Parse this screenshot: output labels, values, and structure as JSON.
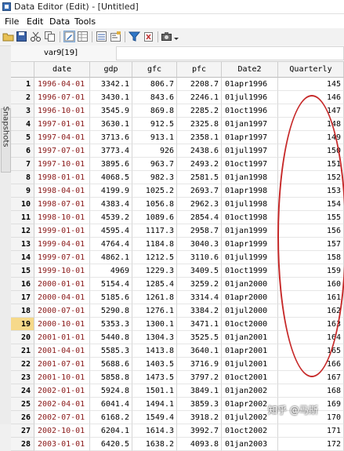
{
  "window": {
    "title": "Data Editor (Edit) - [Untitled]"
  },
  "menu": [
    "File",
    "Edit",
    "Data",
    "Tools"
  ],
  "toolbar": {
    "icons": [
      "open-icon",
      "save-icon",
      "cut-icon",
      "copy-icon",
      "edit-mode-icon",
      "browse-mode-icon",
      "variables-icon",
      "properties-icon",
      "filter-icon",
      "delete-icon",
      "snapshot-icon",
      "dropdown-icon"
    ]
  },
  "sidebar": {
    "label": "Snapshots"
  },
  "varbar": {
    "name": "var9[19]"
  },
  "grid": {
    "columns": [
      "date",
      "gdp",
      "gfc",
      "pfc",
      "Date2",
      "Quarterly"
    ],
    "selected_row": 19,
    "rows": [
      {
        "n": "1",
        "date": "1996-04-01",
        "gdp": "3342.1",
        "gfc": "806.7",
        "pfc": "2208.7",
        "d2": "01apr1996",
        "q": "145"
      },
      {
        "n": "2",
        "date": "1996-07-01",
        "gdp": "3430.1",
        "gfc": "843.6",
        "pfc": "2246.1",
        "d2": "01jul1996",
        "q": "146"
      },
      {
        "n": "3",
        "date": "1996-10-01",
        "gdp": "3545.9",
        "gfc": "869.8",
        "pfc": "2285.2",
        "d2": "01oct1996",
        "q": "147"
      },
      {
        "n": "4",
        "date": "1997-01-01",
        "gdp": "3630.1",
        "gfc": "912.5",
        "pfc": "2325.8",
        "d2": "01jan1997",
        "q": "148"
      },
      {
        "n": "5",
        "date": "1997-04-01",
        "gdp": "3713.6",
        "gfc": "913.1",
        "pfc": "2358.1",
        "d2": "01apr1997",
        "q": "149"
      },
      {
        "n": "6",
        "date": "1997-07-01",
        "gdp": "3773.4",
        "gfc": "926",
        "pfc": "2438.6",
        "d2": "01jul1997",
        "q": "150"
      },
      {
        "n": "7",
        "date": "1997-10-01",
        "gdp": "3895.6",
        "gfc": "963.7",
        "pfc": "2493.2",
        "d2": "01oct1997",
        "q": "151"
      },
      {
        "n": "8",
        "date": "1998-01-01",
        "gdp": "4068.5",
        "gfc": "982.3",
        "pfc": "2581.5",
        "d2": "01jan1998",
        "q": "152"
      },
      {
        "n": "9",
        "date": "1998-04-01",
        "gdp": "4199.9",
        "gfc": "1025.2",
        "pfc": "2693.7",
        "d2": "01apr1998",
        "q": "153"
      },
      {
        "n": "10",
        "date": "1998-07-01",
        "gdp": "4383.4",
        "gfc": "1056.8",
        "pfc": "2962.3",
        "d2": "01jul1998",
        "q": "154"
      },
      {
        "n": "11",
        "date": "1998-10-01",
        "gdp": "4539.2",
        "gfc": "1089.6",
        "pfc": "2854.4",
        "d2": "01oct1998",
        "q": "155"
      },
      {
        "n": "12",
        "date": "1999-01-01",
        "gdp": "4595.4",
        "gfc": "1117.3",
        "pfc": "2958.7",
        "d2": "01jan1999",
        "q": "156"
      },
      {
        "n": "13",
        "date": "1999-04-01",
        "gdp": "4764.4",
        "gfc": "1184.8",
        "pfc": "3040.3",
        "d2": "01apr1999",
        "q": "157"
      },
      {
        "n": "14",
        "date": "1999-07-01",
        "gdp": "4862.1",
        "gfc": "1212.5",
        "pfc": "3110.6",
        "d2": "01jul1999",
        "q": "158"
      },
      {
        "n": "15",
        "date": "1999-10-01",
        "gdp": "4969",
        "gfc": "1229.3",
        "pfc": "3409.5",
        "d2": "01oct1999",
        "q": "159"
      },
      {
        "n": "16",
        "date": "2000-01-01",
        "gdp": "5154.4",
        "gfc": "1285.4",
        "pfc": "3259.2",
        "d2": "01jan2000",
        "q": "160"
      },
      {
        "n": "17",
        "date": "2000-04-01",
        "gdp": "5185.6",
        "gfc": "1261.8",
        "pfc": "3314.4",
        "d2": "01apr2000",
        "q": "161"
      },
      {
        "n": "18",
        "date": "2000-07-01",
        "gdp": "5290.8",
        "gfc": "1276.1",
        "pfc": "3384.2",
        "d2": "01jul2000",
        "q": "162"
      },
      {
        "n": "19",
        "date": "2000-10-01",
        "gdp": "5353.3",
        "gfc": "1300.1",
        "pfc": "3471.1",
        "d2": "01oct2000",
        "q": "163"
      },
      {
        "n": "20",
        "date": "2001-01-01",
        "gdp": "5440.8",
        "gfc": "1304.3",
        "pfc": "3525.5",
        "d2": "01jan2001",
        "q": "164"
      },
      {
        "n": "21",
        "date": "2001-04-01",
        "gdp": "5585.3",
        "gfc": "1413.8",
        "pfc": "3640.1",
        "d2": "01apr2001",
        "q": "165"
      },
      {
        "n": "22",
        "date": "2001-07-01",
        "gdp": "5688.6",
        "gfc": "1403.5",
        "pfc": "3716.9",
        "d2": "01jul2001",
        "q": "166"
      },
      {
        "n": "23",
        "date": "2001-10-01",
        "gdp": "5858.8",
        "gfc": "1473.5",
        "pfc": "3797.2",
        "d2": "01oct2001",
        "q": "167"
      },
      {
        "n": "24",
        "date": "2002-01-01",
        "gdp": "5924.8",
        "gfc": "1501.1",
        "pfc": "3849.1",
        "d2": "01jan2002",
        "q": "168"
      },
      {
        "n": "25",
        "date": "2002-04-01",
        "gdp": "6041.4",
        "gfc": "1494.1",
        "pfc": "3859.3",
        "d2": "01apr2002",
        "q": "169"
      },
      {
        "n": "26",
        "date": "2002-07-01",
        "gdp": "6168.2",
        "gfc": "1549.4",
        "pfc": "3918.2",
        "d2": "01jul2002",
        "q": "170"
      },
      {
        "n": "27",
        "date": "2002-10-01",
        "gdp": "6204.1",
        "gfc": "1614.3",
        "pfc": "3992.7",
        "d2": "01oct2002",
        "q": "171"
      },
      {
        "n": "28",
        "date": "2003-01-01",
        "gdp": "6420.5",
        "gfc": "1638.2",
        "pfc": "4093.8",
        "d2": "01jan2003",
        "q": "172"
      }
    ]
  },
  "annotation": {
    "color": "#c62828"
  },
  "watermark": {
    "text": "知乎 @马斯"
  }
}
